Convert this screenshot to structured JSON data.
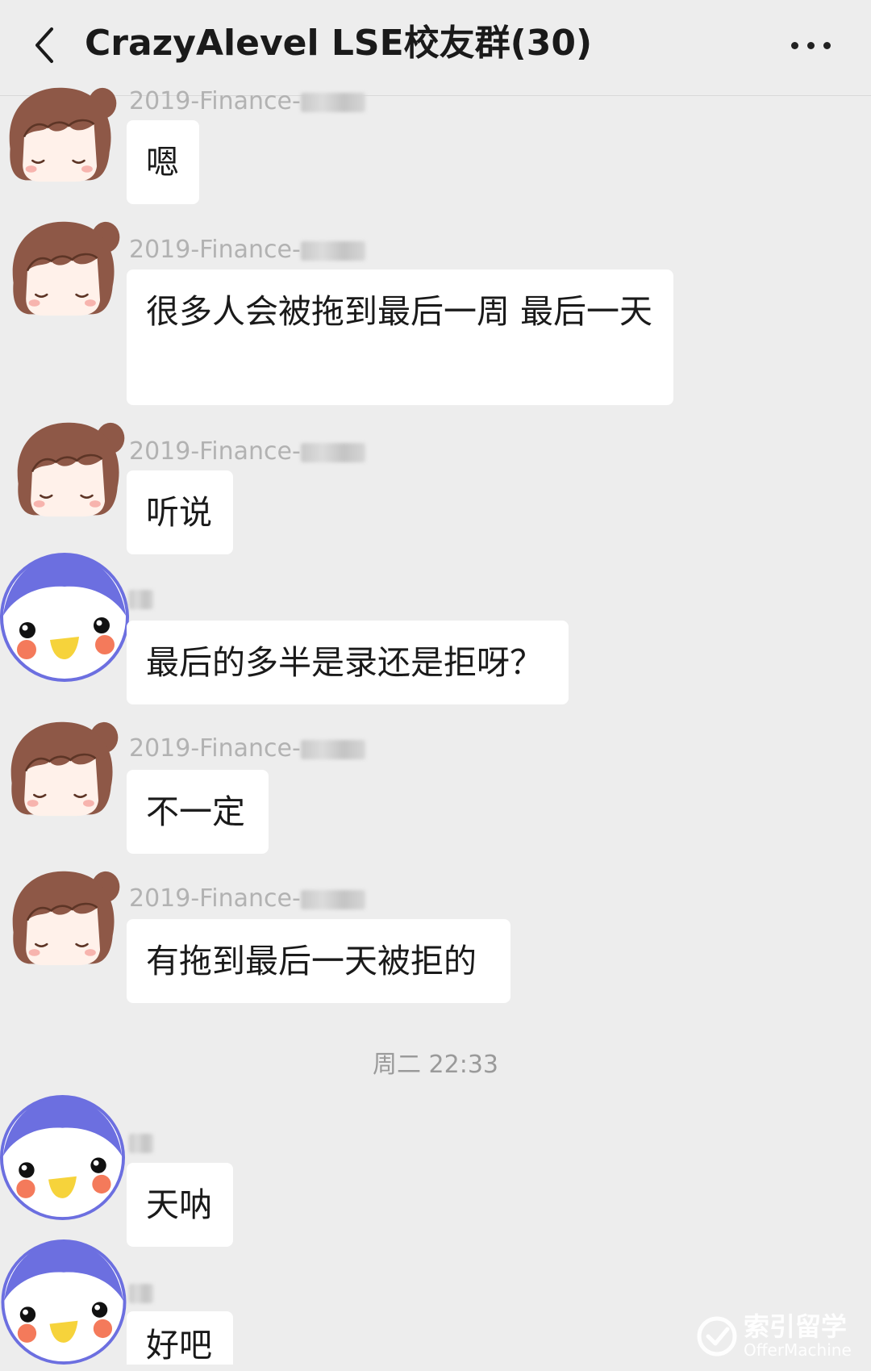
{
  "header": {
    "title": "CrazyAlevel LSE校友群(30)",
    "back_icon": "chevron-left-icon",
    "more_icon": "more-dots-icon"
  },
  "sender_names": {
    "finance_prefix": "2019-Finance-"
  },
  "messages": [
    {
      "text": "嗯"
    },
    {
      "text": "很多人会被拖到最后一周 最后一天"
    },
    {
      "text": "听说"
    },
    {
      "text": "最后的多半是录还是拒呀？"
    },
    {
      "text": "不一定"
    },
    {
      "text": "有拖到最后一天被拒的"
    },
    {
      "text": "天呐"
    },
    {
      "text": "好吧"
    }
  ],
  "timestamp": "周二 22:33",
  "watermark": {
    "title": "索引留学",
    "subtitle": "OfferMachine"
  },
  "colors": {
    "background": "#ededed",
    "bubble": "#ffffff",
    "girl_hair": "#8e5847",
    "girl_face": "#fff1ea",
    "penguin_body": "#6c6fe0",
    "penguin_beak": "#f6d33b",
    "penguin_cheek": "#f47a5b"
  }
}
